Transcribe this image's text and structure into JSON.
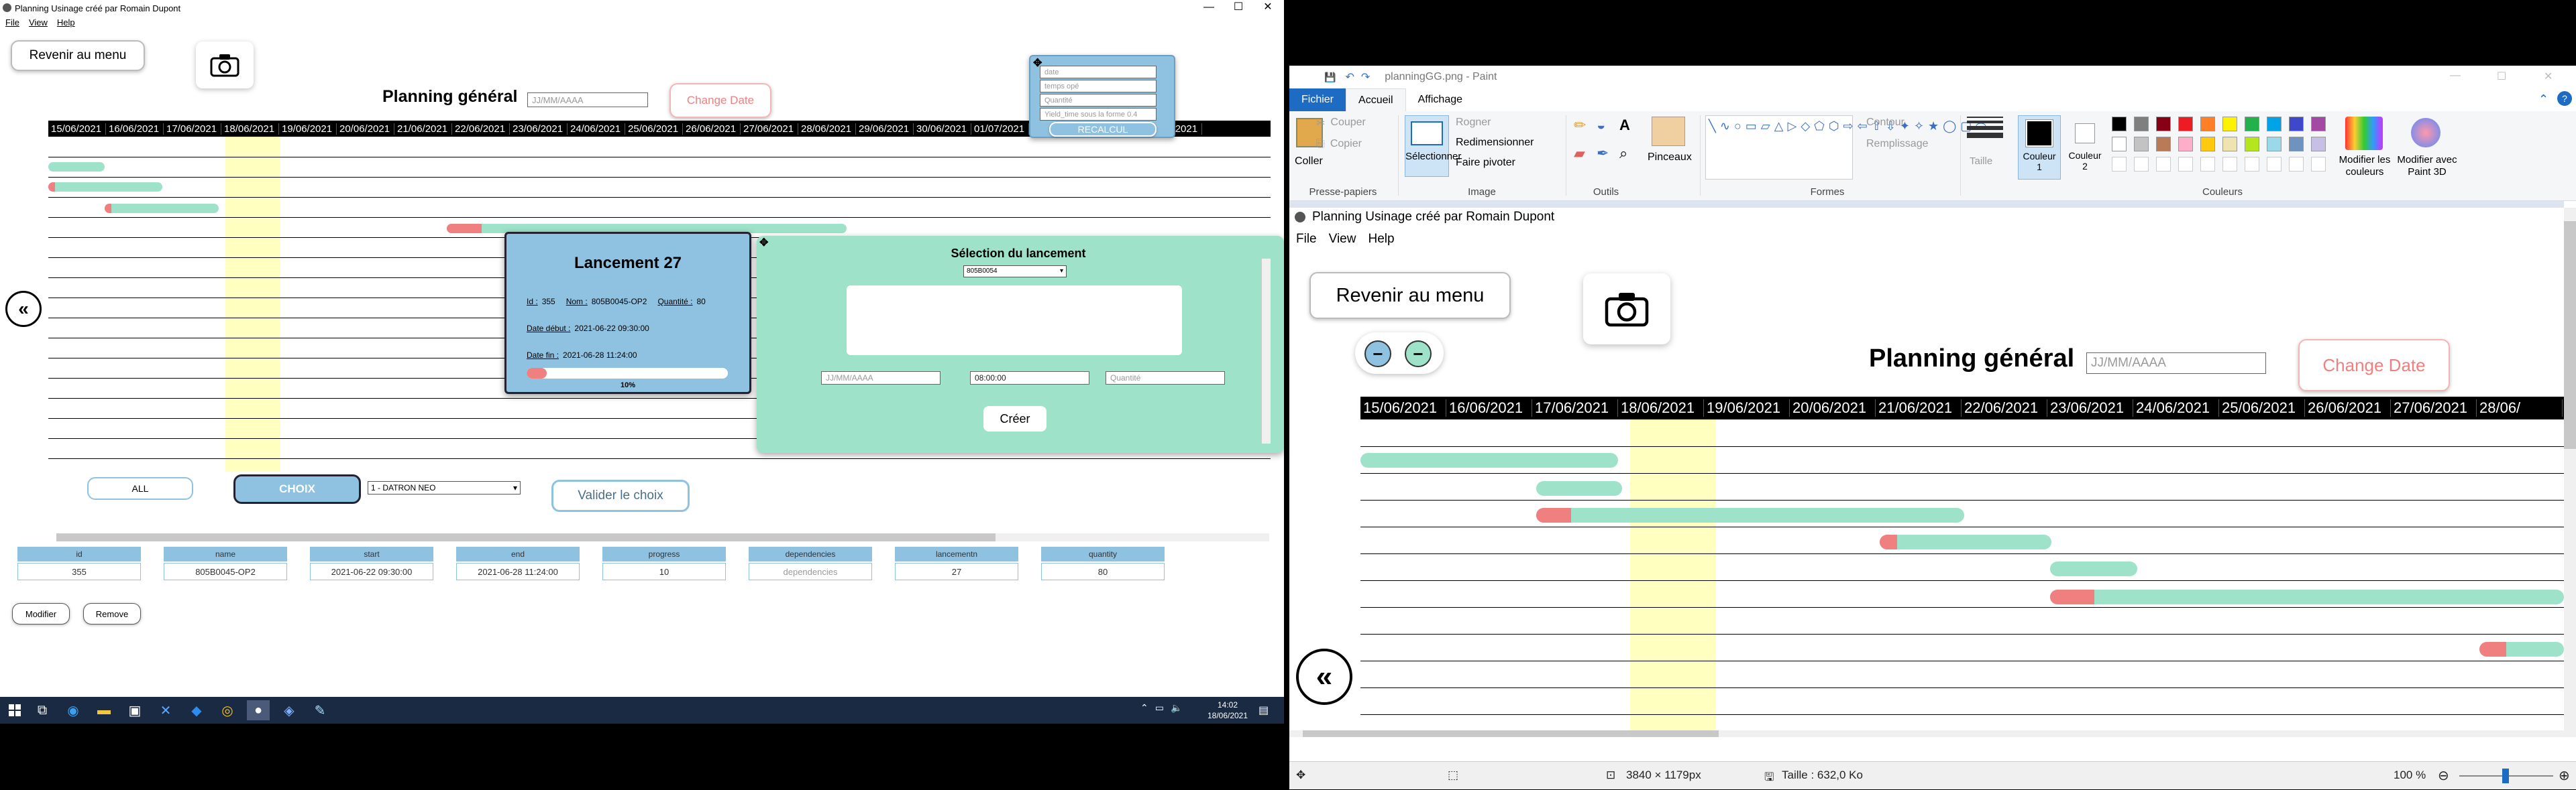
{
  "left_window": {
    "title": "Planning Usinage créé par Romain Dupont",
    "menu": [
      "File",
      "View",
      "Help"
    ],
    "back_menu_label": "Revenir au menu",
    "page_title": "Planning général",
    "date_placeholder": "JJ/MM/AAAA",
    "change_date_label": "Change Date",
    "dates": [
      "15/06/2021",
      "16/06/2021",
      "17/06/2021",
      "18/06/2021",
      "19/06/2021",
      "20/06/2021",
      "21/06/2021",
      "22/06/2021",
      "23/06/2021",
      "24/06/2021",
      "25/06/2021",
      "26/06/2021",
      "27/06/2021",
      "28/06/2021",
      "29/06/2021",
      "30/06/2021",
      "01/07/2021",
      "",
      "",
      "05/07/2021"
    ],
    "recalc_panel": {
      "fields": [
        "date",
        "temps opé",
        "Quantité",
        "Yield_time sous la forme 0.4"
      ],
      "button": "RECALCUL"
    },
    "launch_card": {
      "title": "Lancement 27",
      "id_label": "Id :",
      "id_value": "355",
      "name_label": "Nom :",
      "name_value": "805B0045-OP2",
      "qty_label": "Quantité :",
      "qty_value": "80",
      "start_label": "Date début :",
      "start_value": "2021-06-22 09:30:00",
      "end_label": "Date fin :",
      "end_value": "2021-06-28 11:24:00",
      "progress_label": "10%",
      "progress": 0.1
    },
    "selection_panel": {
      "title": "Sélection du lancement",
      "select_value": "805B0054",
      "date_placeholder": "JJ/MM/AAAA",
      "time_value": "08:00:00",
      "qty_placeholder": "Quantité",
      "create_button": "Créer"
    },
    "filter": {
      "all_label": "ALL",
      "choix_label": "CHOIX",
      "select_value": "1 - DATRON NEO",
      "validate_label": "Valider le choix"
    },
    "table": {
      "headers": [
        "id",
        "name",
        "start",
        "end",
        "progress",
        "dependencies",
        "lancementn",
        "quantity"
      ],
      "values": [
        "355",
        "805B0045-OP2",
        "2021-06-22 09:30:00",
        "2021-06-28 11:24:00",
        "10",
        "dependencies",
        "27",
        "80"
      ]
    },
    "modify_label": "Modifier",
    "remove_label": "Remove"
  },
  "taskbar": {
    "time": "14:02",
    "date": "18/06/2021"
  },
  "paint": {
    "title": "planningGG.png - Paint",
    "tabs": [
      "Fichier",
      "Accueil",
      "Affichage"
    ],
    "groups": {
      "clipboard": "Presse-papiers",
      "image": "Image",
      "tools": "Outils",
      "shapes": "Formes",
      "colors": "Couleurs"
    },
    "clipboard": {
      "paste": "Coller",
      "cut": "Couper",
      "copy": "Copier"
    },
    "image": {
      "select": "Sélectionner",
      "crop": "Rogner",
      "resize": "Redimensionner",
      "rotate": "Faire pivoter"
    },
    "brushes": "Pinceaux",
    "outline": "Contour",
    "fill": "Remplissage",
    "size": "Taille",
    "color1": "Couleur 1",
    "color2": "Couleur 2",
    "edit_colors": "Modifier les couleurs",
    "paint3d": "Modifier avec Paint 3D",
    "canvas": {
      "title": "Planning Usinage créé par Romain Dupont",
      "menu": [
        "File",
        "View",
        "Help"
      ],
      "back_menu_label": "Revenir au menu",
      "page_title": "Planning général",
      "date_placeholder": "JJ/MM/AAAA",
      "change_date_label": "Change Date",
      "dates": [
        "15/06/2021",
        "16/06/2021",
        "17/06/2021",
        "18/06/2021",
        "19/06/2021",
        "20/06/2021",
        "21/06/2021",
        "22/06/2021",
        "23/06/2021",
        "24/06/2021",
        "25/06/2021",
        "26/06/2021",
        "27/06/2021",
        "28/06/"
      ]
    },
    "status": {
      "dimensions": "3840 × 1179px",
      "size": "Taille : 632,0 Ko",
      "zoom": "100 %"
    },
    "palette": [
      "#000000",
      "#7f7f7f",
      "#880015",
      "#ed1c24",
      "#ff7f27",
      "#fff200",
      "#22b14c",
      "#00a2e8",
      "#3f48cc",
      "#a349a4",
      "#ffffff",
      "#c3c3c3",
      "#b97a57",
      "#ffaec9",
      "#ffc90e",
      "#efe4b0",
      "#b5e61d",
      "#99d9ea",
      "#7092be",
      "#c8bfe7"
    ]
  }
}
